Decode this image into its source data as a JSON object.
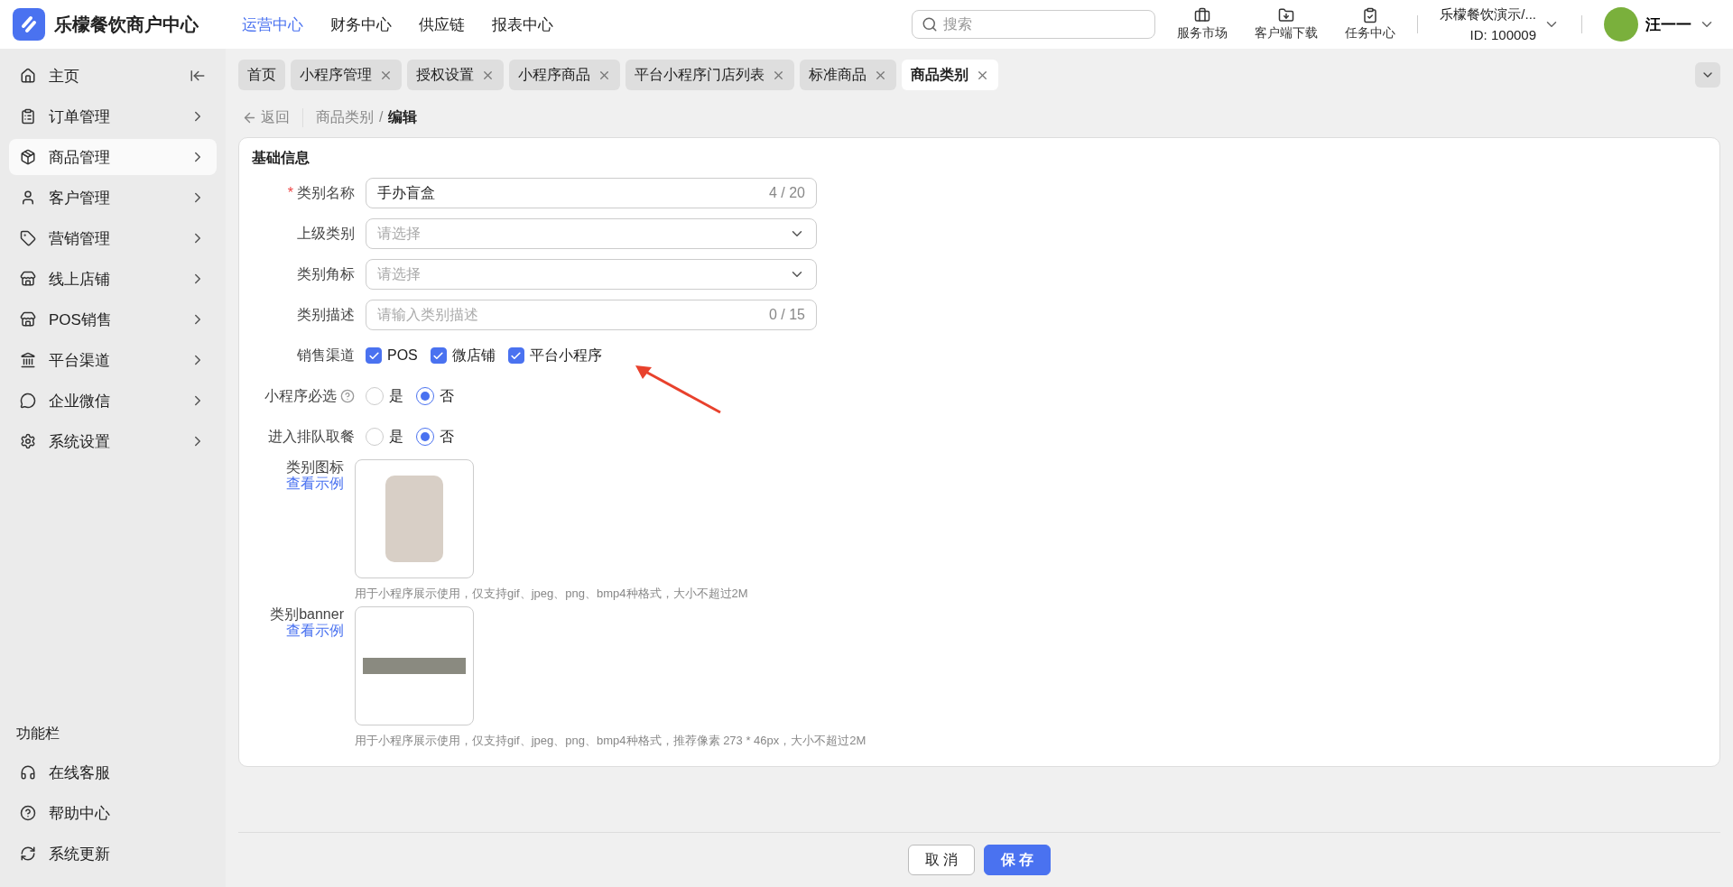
{
  "header": {
    "logo": "乐檬餐饮商户中心",
    "nav": [
      {
        "label": "运营中心",
        "selected": true
      },
      {
        "label": "财务中心",
        "selected": false
      },
      {
        "label": "供应链",
        "selected": false
      },
      {
        "label": "报表中心",
        "selected": false
      }
    ],
    "search": {
      "placeholder": "搜索"
    },
    "tools": [
      "服务市场",
      "客户端下载",
      "任务中心"
    ],
    "account": {
      "name": "乐檬餐饮演示/...",
      "id": "ID: 100009"
    },
    "user": "汪一一"
  },
  "sidebar": {
    "items": [
      {
        "label": "主页",
        "kind": "home",
        "selected": false
      },
      {
        "label": "订单管理",
        "kind": "group",
        "selected": false
      },
      {
        "label": "商品管理",
        "kind": "group",
        "selected": true
      },
      {
        "label": "客户管理",
        "kind": "group",
        "selected": false
      },
      {
        "label": "营销管理",
        "kind": "group",
        "selected": false
      },
      {
        "label": "线上店铺",
        "kind": "group",
        "selected": false
      },
      {
        "label": "POS销售",
        "kind": "group",
        "selected": false
      },
      {
        "label": "平台渠道",
        "kind": "group",
        "selected": false
      },
      {
        "label": "企业微信",
        "kind": "group",
        "selected": false
      },
      {
        "label": "系统设置",
        "kind": "group",
        "selected": false
      }
    ],
    "footer_title": "功能栏",
    "footer_items": [
      "在线客服",
      "帮助中心",
      "系统更新"
    ]
  },
  "tabs": [
    {
      "label": "首页",
      "closable": false,
      "selected": false
    },
    {
      "label": "小程序管理",
      "closable": true,
      "selected": false
    },
    {
      "label": "授权设置",
      "closable": true,
      "selected": false
    },
    {
      "label": "小程序商品",
      "closable": true,
      "selected": false
    },
    {
      "label": "平台小程序门店列表",
      "closable": true,
      "selected": false
    },
    {
      "label": "标准商品",
      "closable": true,
      "selected": false
    },
    {
      "label": "商品类别",
      "closable": true,
      "selected": true
    }
  ],
  "breadcrumb": {
    "back": "返回",
    "path": "商品类别",
    "separator": "/",
    "current": "编辑"
  },
  "form": {
    "title": "基础信息",
    "rows": [
      {
        "kind": "text",
        "label": "类别名称",
        "required_mark": "*",
        "value": "手办盲盒",
        "counter": "4 / 20"
      },
      {
        "kind": "select",
        "label": "上级类别",
        "placeholder": "请选择"
      },
      {
        "kind": "select",
        "label": "类别角标",
        "placeholder": "请选择"
      },
      {
        "kind": "text",
        "label": "类别描述",
        "placeholder": "请输入类别描述",
        "counter": "0 / 15"
      },
      {
        "kind": "checkboxes",
        "label": "销售渠道",
        "options": [
          {
            "label": "POS",
            "checked": true
          },
          {
            "label": "微店铺",
            "checked": true
          },
          {
            "label": "平台小程序",
            "checked": true
          }
        ]
      },
      {
        "kind": "radios",
        "label": "小程序必选",
        "help": true,
        "options": [
          {
            "label": "是",
            "selected": false
          },
          {
            "label": "否",
            "selected": true
          }
        ]
      },
      {
        "kind": "radios",
        "label": "进入排队取餐",
        "options": [
          {
            "label": "是",
            "selected": false
          },
          {
            "label": "否",
            "selected": true
          }
        ]
      },
      {
        "kind": "upload",
        "label": "类别图标",
        "link": "查看示例",
        "hint": "用于小程序展示使用，仅支持gif、jpeg、png、bmp4种格式，大小不超过2M"
      },
      {
        "kind": "upload",
        "label": "类别banner",
        "link": "查看示例",
        "hint": "用于小程序展示使用，仅支持gif、jpeg、png、bmp4种格式，推荐像素 273 * 46px，大小不超过2M"
      }
    ]
  },
  "footer": {
    "buttons": [
      {
        "label": "取 消",
        "kind": "default"
      },
      {
        "label": "保 存",
        "kind": "primary"
      }
    ]
  }
}
